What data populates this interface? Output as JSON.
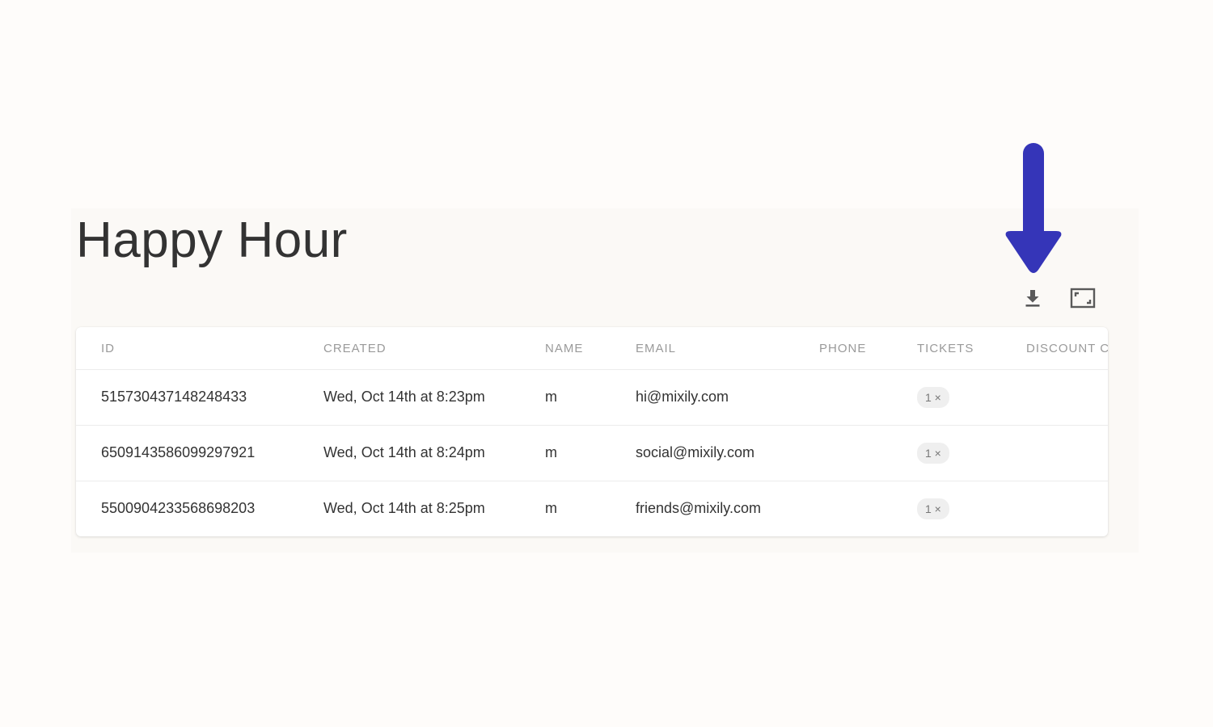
{
  "page": {
    "title": "Happy Hour"
  },
  "toolbar": {
    "download_icon": "download-icon",
    "fullscreen_icon": "fullscreen-icon"
  },
  "annotation": {
    "arrow_color": "#3535b8"
  },
  "table": {
    "columns": [
      "ID",
      "CREATED",
      "NAME",
      "EMAIL",
      "PHONE",
      "TICKETS",
      "DISCOUNT C"
    ],
    "rows": [
      {
        "id": "515730437148248433",
        "created": "Wed, Oct 14th at 8:23pm",
        "name": "m",
        "email": "hi@mixily.com",
        "phone": "",
        "tickets": "1 ×",
        "discount": ""
      },
      {
        "id": "6509143586099297921",
        "created": "Wed, Oct 14th at 8:24pm",
        "name": "m",
        "email": "social@mixily.com",
        "phone": "",
        "tickets": "1 ×",
        "discount": ""
      },
      {
        "id": "5500904233568698203",
        "created": "Wed, Oct 14th at 8:25pm",
        "name": "m",
        "email": "friends@mixily.com",
        "phone": "",
        "tickets": "1 ×",
        "discount": ""
      }
    ]
  }
}
